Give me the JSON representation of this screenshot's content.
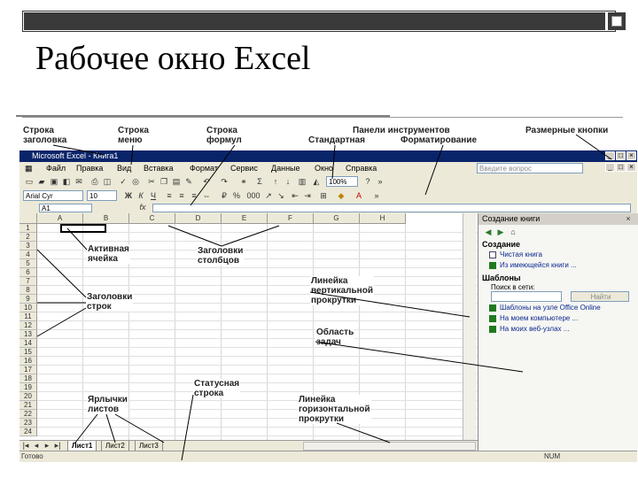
{
  "slide": {
    "title": "Рабочее окно Excel"
  },
  "annotations": {
    "title_row": "Строка\nзаголовка",
    "menu_row": "Строка\nменю",
    "formula_row": "Строка\nформул",
    "toolbars": "Панели инструментов",
    "standard": "Стандартная",
    "formatting": "Форматирование",
    "size_buttons": "Размерные кнопки",
    "active_cell": "Активная\nячейка",
    "col_headers": "Заголовки\nстолбцов",
    "row_headers": "Заголовки\nстрок",
    "vscroll": "Линейка\nвертикальной\nпрокрутки",
    "task_area": "Область\nзадач",
    "status_row": "Статусная\nстрока",
    "sheet_tabs": "Ярлычки\nлистов",
    "hscroll": "Линейка\nгоризонтальной\nпрокрутки"
  },
  "excel": {
    "title": "Microsoft Excel - Книга1",
    "menu": [
      "Файл",
      "Правка",
      "Вид",
      "Вставка",
      "Формат",
      "Сервис",
      "Данные",
      "Окно",
      "Справка"
    ],
    "question_placeholder": "Введите вопрос",
    "zoom": "100%",
    "font_name": "Arial Cyr",
    "font_size": "10",
    "name_box": "A1",
    "fx": "fx",
    "columns": [
      "A",
      "B",
      "C",
      "D",
      "E",
      "F",
      "G",
      "H"
    ],
    "rows": [
      "1",
      "2",
      "3",
      "4",
      "5",
      "6",
      "7",
      "8",
      "9",
      "10",
      "11",
      "12",
      "13",
      "14",
      "15",
      "16",
      "17",
      "18",
      "19",
      "20",
      "21",
      "22",
      "23",
      "24"
    ],
    "sheet_tabs": [
      "Лист1",
      "Лист2",
      "Лист3"
    ],
    "status_left": "Готово",
    "status_right": "NUM",
    "task_pane": {
      "title": "Создание книги",
      "section_create": "Создание",
      "link_blank": "Чистая книга",
      "link_existing": "Из имеющейся книги ...",
      "section_templates": "Шаблоны",
      "search_placeholder": "Поиск в сети:",
      "find_button": "Найти",
      "link_office_online": "Шаблоны на узле Office Online",
      "link_my_computer": "На моем компьютере ...",
      "link_web": "На моих веб-узлах ..."
    }
  },
  "colors": {
    "title_bar": "#0a246a",
    "chrome": "#ece9d8",
    "link": "#0b2a90"
  }
}
